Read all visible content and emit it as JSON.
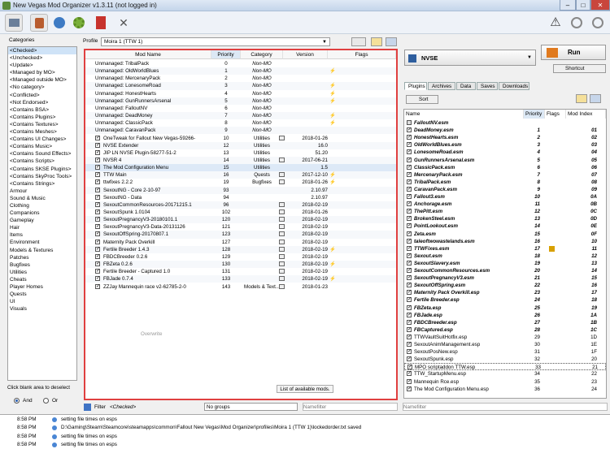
{
  "window": {
    "title": "New Vegas Mod Organizer v1.3.11 (not logged in)",
    "minimize": "–",
    "maximize": "□",
    "close": "✕"
  },
  "toolbar": {
    "icons": [
      "folder-open-icon",
      "install-mod-icon",
      "nexus-icon",
      "settings-gear-icon",
      "executables-icon",
      "tools-icon",
      "warning-icon",
      "update-icon",
      "help-icon"
    ]
  },
  "categories": {
    "label": "Categories",
    "items": [
      "<Checked>",
      "<Unchecked>",
      "<Update>",
      "<Managed by MO>",
      "<Managed outside MO>",
      "<No category>",
      "<Conflicted>",
      "<Not Endorsed>",
      "<Contains BSA>",
      "<Contains Plugins>",
      "<Contains Textures>",
      "<Contains Meshes>",
      "<Contains UI Changes>",
      "<Contains Music>",
      "<Contains Sound Effects>",
      "<Contains Scripts>",
      "<Contains SKSE Plugins>",
      "<Contains SkyProc Tools>",
      "<Contains Strings>",
      "Armour",
      "Sound & Music",
      "Clothing",
      "Companions",
      "Gameplay",
      "Hair",
      "Items",
      "Environment",
      "Models & Textures",
      "Patches",
      "Bugfixes",
      "Utilities",
      "Cheats",
      "Player Homes",
      "Quests",
      "UI",
      "Visuals"
    ],
    "hint": "Click blank area to deselect",
    "and_label": "And",
    "or_label": "Or"
  },
  "profile": {
    "label": "Profile",
    "value": "Moira 1 (TTW 1)"
  },
  "modlist": {
    "headers": [
      "Mod Name",
      "Priority",
      "Category",
      "Version",
      "Flags"
    ],
    "rows": [
      {
        "checked": false,
        "name": "Unmanaged: TribalPack",
        "priority": "0",
        "category": "Non-MO",
        "version": "",
        "flag": ""
      },
      {
        "checked": false,
        "name": "Unmanaged: OldWorldBlues",
        "priority": "1",
        "category": "Non-MO",
        "version": "",
        "flag": "⚡"
      },
      {
        "checked": false,
        "name": "Unmanaged: MercenaryPack",
        "priority": "2",
        "category": "Non-MO",
        "version": "",
        "flag": ""
      },
      {
        "checked": false,
        "name": "Unmanaged: LonesomeRoad",
        "priority": "3",
        "category": "Non-MO",
        "version": "",
        "flag": "⚡"
      },
      {
        "checked": false,
        "name": "Unmanaged: HonestHearts",
        "priority": "4",
        "category": "Non-MO",
        "version": "",
        "flag": "⚡"
      },
      {
        "checked": false,
        "name": "Unmanaged: GunRunnersArsenal",
        "priority": "5",
        "category": "Non-MO",
        "version": "",
        "flag": "⚡"
      },
      {
        "checked": false,
        "name": "Unmanaged: FalloutNV",
        "priority": "6",
        "category": "Non-MO",
        "version": "",
        "flag": ""
      },
      {
        "checked": false,
        "name": "Unmanaged: DeadMoney",
        "priority": "7",
        "category": "Non-MO",
        "version": "",
        "flag": "⚡"
      },
      {
        "checked": false,
        "name": "Unmanaged: ClassicPack",
        "priority": "8",
        "category": "Non-MO",
        "version": "",
        "flag": "⚡"
      },
      {
        "checked": false,
        "name": "Unmanaged: CaravanPack",
        "priority": "9",
        "category": "Non-MO",
        "version": "",
        "flag": ""
      },
      {
        "checked": true,
        "name": "OneTweak for Fallout New Vegas-59266-",
        "priority": "10",
        "category": "Utilities",
        "version": "2018-01-26",
        "flag": ""
      },
      {
        "checked": true,
        "name": "NVSE Extender",
        "priority": "12",
        "category": "Utilities",
        "version": "16.0",
        "flag": ""
      },
      {
        "checked": true,
        "name": "JIP LN NVSE Plugin-58277-51-2",
        "priority": "13",
        "category": "Utilities",
        "version": "51.20",
        "flag": ""
      },
      {
        "checked": true,
        "name": "NVSR 4",
        "priority": "14",
        "category": "Utilities",
        "version": "2017-06-21",
        "flag": ""
      },
      {
        "checked": true,
        "name": "The Mod Configuration Menu",
        "priority": "15",
        "category": "Utilities",
        "version": "1.5",
        "flag": ""
      },
      {
        "checked": true,
        "name": "TTW Main",
        "priority": "16",
        "category": "Quests",
        "version": "2017-12-10",
        "flag": "⚡"
      },
      {
        "checked": true,
        "name": "ttwfixes 2.2.2",
        "priority": "19",
        "category": "Bugfixes",
        "version": "2018-01-26",
        "flag": "⚡"
      },
      {
        "checked": true,
        "name": "SexoutNG - Core 2-10-97",
        "priority": "93",
        "category": "",
        "version": "2.10.97",
        "flag": ""
      },
      {
        "checked": true,
        "name": "SexoutNG - Data",
        "priority": "94",
        "category": "",
        "version": "2.10.97",
        "flag": ""
      },
      {
        "checked": true,
        "name": "SexoutCommonResources-20171215.1",
        "priority": "96",
        "category": "",
        "version": "2018-02-19",
        "flag": ""
      },
      {
        "checked": true,
        "name": "SexoutSpunk 1.0104",
        "priority": "102",
        "category": "",
        "version": "2018-01-26",
        "flag": ""
      },
      {
        "checked": true,
        "name": "SexoutPregnancyV3-20180101.1",
        "priority": "120",
        "category": "",
        "version": "2018-02-19",
        "flag": ""
      },
      {
        "checked": true,
        "name": "SexoutPregnancyV3-Data-20131126",
        "priority": "121",
        "category": "",
        "version": "2018-02-19",
        "flag": ""
      },
      {
        "checked": true,
        "name": "SexoutOffSpring-20170807.1",
        "priority": "123",
        "category": "",
        "version": "2018-02-19",
        "flag": ""
      },
      {
        "checked": true,
        "name": "Maternity Pack Overkill",
        "priority": "127",
        "category": "",
        "version": "2018-02-19",
        "flag": ""
      },
      {
        "checked": true,
        "name": "Fertile Breeder 1.4.3",
        "priority": "128",
        "category": "",
        "version": "2018-02-19",
        "flag": "⚡"
      },
      {
        "checked": true,
        "name": "FBDCBreeder 0.2.6",
        "priority": "129",
        "category": "",
        "version": "2018-02-19",
        "flag": ""
      },
      {
        "checked": true,
        "name": "FBZeta 0.2.6",
        "priority": "130",
        "category": "",
        "version": "2018-02-19",
        "flag": "⚡"
      },
      {
        "checked": true,
        "name": "Fertile Breeder - Captured 1.0",
        "priority": "131",
        "category": "",
        "version": "2018-02-19",
        "flag": ""
      },
      {
        "checked": true,
        "name": "FBJade 0.7.4",
        "priority": "133",
        "category": "",
        "version": "2018-02-19",
        "flag": "⚡"
      },
      {
        "checked": true,
        "name": "ZZJay Mannequin race v2-62785-2-0",
        "priority": "143",
        "category": "Models & Text...",
        "version": "2018-01-23",
        "flag": ""
      }
    ],
    "overwrite": "Overwrite",
    "available_mods": "List of available mods."
  },
  "filterbar": {
    "label": "Filter",
    "checked": "<Checked>",
    "groups": "No groups",
    "namefilter_placeholder": "Namefilter"
  },
  "run": {
    "executable": "NVSE",
    "run_label": "Run",
    "shortcut_label": "Shortcut"
  },
  "tabs": [
    "Plugins",
    "Archives",
    "Data",
    "Saves",
    "Downloads"
  ],
  "sort_label": "Sort",
  "plugins": {
    "headers": [
      "Name",
      "Priority",
      "Flags",
      "Mod Index"
    ],
    "rows": [
      {
        "name": "FalloutNV.esm",
        "priority": "",
        "index": "",
        "bold": true,
        "checked": false
      },
      {
        "name": "DeadMoney.esm",
        "priority": "1",
        "index": "01",
        "bold": true,
        "checked": true
      },
      {
        "name": "HonestHearts.esm",
        "priority": "2",
        "index": "02",
        "bold": true,
        "checked": true
      },
      {
        "name": "OldWorldBlues.esm",
        "priority": "3",
        "index": "03",
        "bold": true,
        "checked": true
      },
      {
        "name": "LonesomeRoad.esm",
        "priority": "4",
        "index": "04",
        "bold": true,
        "checked": true
      },
      {
        "name": "GunRunnersArsenal.esm",
        "priority": "5",
        "index": "05",
        "bold": true,
        "checked": true
      },
      {
        "name": "ClassicPack.esm",
        "priority": "6",
        "index": "06",
        "bold": true,
        "checked": true
      },
      {
        "name": "MercenaryPack.esm",
        "priority": "7",
        "index": "07",
        "bold": true,
        "checked": true
      },
      {
        "name": "TribalPack.esm",
        "priority": "8",
        "index": "08",
        "bold": true,
        "checked": true
      },
      {
        "name": "CaravanPack.esm",
        "priority": "9",
        "index": "09",
        "bold": true,
        "checked": true
      },
      {
        "name": "Fallout3.esm",
        "priority": "10",
        "index": "0A",
        "bold": true,
        "checked": true
      },
      {
        "name": "Anchorage.esm",
        "priority": "11",
        "index": "0B",
        "bold": true,
        "checked": true
      },
      {
        "name": "ThePitt.esm",
        "priority": "12",
        "index": "0C",
        "bold": true,
        "checked": true
      },
      {
        "name": "BrokenSteel.esm",
        "priority": "13",
        "index": "0D",
        "bold": true,
        "checked": true
      },
      {
        "name": "PointLookout.esm",
        "priority": "14",
        "index": "0E",
        "bold": true,
        "checked": true
      },
      {
        "name": "Zeta.esm",
        "priority": "15",
        "index": "0F",
        "bold": true,
        "checked": true
      },
      {
        "name": "taleoftwowastelands.esm",
        "priority": "16",
        "index": "10",
        "bold": true,
        "checked": true
      },
      {
        "name": "TTWFixes.esm",
        "priority": "17",
        "index": "11",
        "bold": true,
        "checked": true
      },
      {
        "name": "Sexout.esm",
        "priority": "18",
        "index": "12",
        "bold": true,
        "checked": true
      },
      {
        "name": "SexoutSlavery.esm",
        "priority": "19",
        "index": "13",
        "bold": true,
        "checked": true
      },
      {
        "name": "SexoutCommonResources.esm",
        "priority": "20",
        "index": "14",
        "bold": true,
        "checked": true
      },
      {
        "name": "SexoutPregnancyV3.esm",
        "priority": "21",
        "index": "15",
        "bold": true,
        "checked": true
      },
      {
        "name": "SexoutOffSpring.esm",
        "priority": "22",
        "index": "16",
        "bold": true,
        "checked": true
      },
      {
        "name": "Maternity Pack Overkill.esp",
        "priority": "23",
        "index": "17",
        "bold": true,
        "checked": true
      },
      {
        "name": "Fertile Breeder.esp",
        "priority": "24",
        "index": "18",
        "bold": true,
        "checked": true
      },
      {
        "name": "FBZeta.esp",
        "priority": "25",
        "index": "19",
        "bold": true,
        "checked": true
      },
      {
        "name": "FBJade.esp",
        "priority": "26",
        "index": "1A",
        "bold": true,
        "checked": true
      },
      {
        "name": "FBDCBreeder.esp",
        "priority": "27",
        "index": "1B",
        "bold": true,
        "checked": true
      },
      {
        "name": "FBCaptured.esp",
        "priority": "28",
        "index": "1C",
        "bold": true,
        "checked": true
      },
      {
        "name": "TTWVaultSuitHotfix.esp",
        "priority": "29",
        "index": "1D",
        "bold": false,
        "checked": true
      },
      {
        "name": "SexoutAnimManagement.esp",
        "priority": "30",
        "index": "1E",
        "bold": false,
        "checked": true
      },
      {
        "name": "SexoutPosNew.esp",
        "priority": "31",
        "index": "1F",
        "bold": false,
        "checked": true
      },
      {
        "name": "SexoutSpunk.esp",
        "priority": "32",
        "index": "20",
        "bold": false,
        "checked": true
      },
      {
        "name": "MPO scriptaddon TTW.esp",
        "priority": "33",
        "index": "21",
        "bold": false,
        "checked": true
      },
      {
        "name": "TTW_StartupMenu.esp",
        "priority": "34",
        "index": "22",
        "bold": false,
        "checked": true
      },
      {
        "name": "Mannequin Rce.esp",
        "priority": "35",
        "index": "23",
        "bold": false,
        "checked": true
      },
      {
        "name": "The Mod Configuration Menu.esp",
        "priority": "36",
        "index": "24",
        "bold": false,
        "checked": true
      }
    ],
    "namefilter_placeholder": "Namefilter"
  },
  "log": [
    {
      "time": "8:58 PM",
      "text": "setting file times on esps"
    },
    {
      "time": "8:58 PM",
      "text": "D:\\Gaming\\Steam\\Steamcore\\steamapps\\common\\Fallout New Vegas\\Mod Organizer\\profiles\\Moira 1 (TTW 1)\\lockedorder.txt saved"
    },
    {
      "time": "8:58 PM",
      "text": "setting file times on esps"
    },
    {
      "time": "8:58 PM",
      "text": "setting file times on esps"
    }
  ]
}
